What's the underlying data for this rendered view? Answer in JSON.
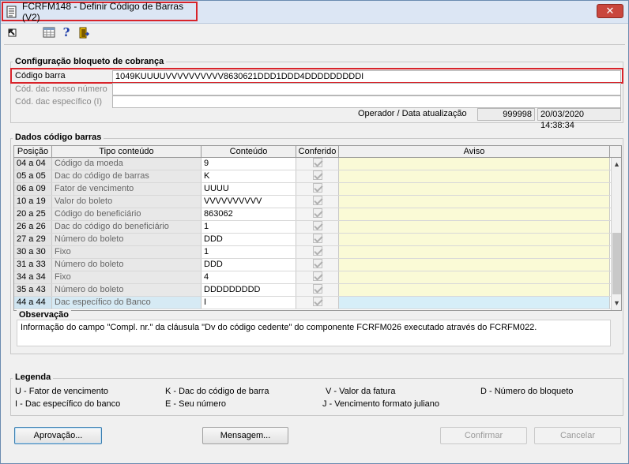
{
  "window": {
    "title": "FCRFM148 - Definir Código de Barras (V2)",
    "close_label": "✕"
  },
  "toolbar": {
    "icons": [
      "arrow-icon",
      "grid-icon",
      "help-icon",
      "exit-icon"
    ]
  },
  "config": {
    "group_title": "Configuração bloqueto de cobrança",
    "codigo_barra_label": "Código barra",
    "codigo_barra_value": "1049KUUUUVVVVVVVVVV8630621DDD1DDD4DDDDDDDDDI",
    "dac_nosso_numero_label": "Cód. dac nosso número",
    "dac_nosso_numero_value": "",
    "dac_especifico_label": "Cód. dac específico (I)",
    "dac_especifico_value": "",
    "operador_label": "Operador / Data atualização",
    "operador_value": "999998",
    "data_value": "20/03/2020 14:38:34"
  },
  "dados": {
    "group_title": "Dados código barras",
    "columns": [
      "Posição",
      "Tipo conteúdo",
      "Conteúdo",
      "Conferido",
      "Aviso"
    ],
    "rows": [
      {
        "pos": "04 a 04",
        "tipo": "Código da moeda",
        "conteudo": "9",
        "aviso": ""
      },
      {
        "pos": "05 a 05",
        "tipo": "Dac do código de barras",
        "conteudo": "K",
        "aviso": ""
      },
      {
        "pos": "06 a 09",
        "tipo": "Fator de vencimento",
        "conteudo": "UUUU",
        "aviso": ""
      },
      {
        "pos": "10 a 19",
        "tipo": "Valor do boleto",
        "conteudo": "VVVVVVVVVV",
        "aviso": ""
      },
      {
        "pos": "20 a 25",
        "tipo": "Código do beneficiário",
        "conteudo": "863062",
        "aviso": ""
      },
      {
        "pos": "26 a 26",
        "tipo": "Dac do código do beneficiário",
        "conteudo": "1",
        "aviso": ""
      },
      {
        "pos": "27 a 29",
        "tipo": "Número do boleto",
        "conteudo": "DDD",
        "aviso": ""
      },
      {
        "pos": "30 a 30",
        "tipo": "Fixo",
        "conteudo": "1",
        "aviso": ""
      },
      {
        "pos": "31 a 33",
        "tipo": "Número do boleto",
        "conteudo": "DDD",
        "aviso": ""
      },
      {
        "pos": "34 a 34",
        "tipo": "Fixo",
        "conteudo": "4",
        "aviso": ""
      },
      {
        "pos": "35 a 43",
        "tipo": "Número do boleto",
        "conteudo": "DDDDDDDDD",
        "aviso": ""
      },
      {
        "pos": "44 a 44",
        "tipo": "Dac específico do Banco",
        "conteudo": "I",
        "aviso": ""
      }
    ],
    "selected_row": 11
  },
  "observacao": {
    "title": "Observação",
    "text": "Informação do campo \"Compl. nr.\" da cláusula \"Dv do código cedente\" do componente FCRFM026 executado através do FCRFM022."
  },
  "legenda": {
    "title": "Legenda",
    "items": [
      "U - Fator de vencimento",
      "K - Dac do código de barra",
      "V - Valor da fatura",
      "D - Número do bloqueto",
      "I - Dac específico do banco",
      "E - Seu número",
      "J - Vencimento formato juliano"
    ]
  },
  "buttons": {
    "aprovacao": "Aprovação...",
    "mensagem": "Mensagem...",
    "confirmar": "Confirmar",
    "cancelar": "Cancelar"
  },
  "colors": {
    "highlight_frame": "#d8232a",
    "aviso_bg": "#fafad6",
    "selected_row_bg": "#d6eef8"
  }
}
